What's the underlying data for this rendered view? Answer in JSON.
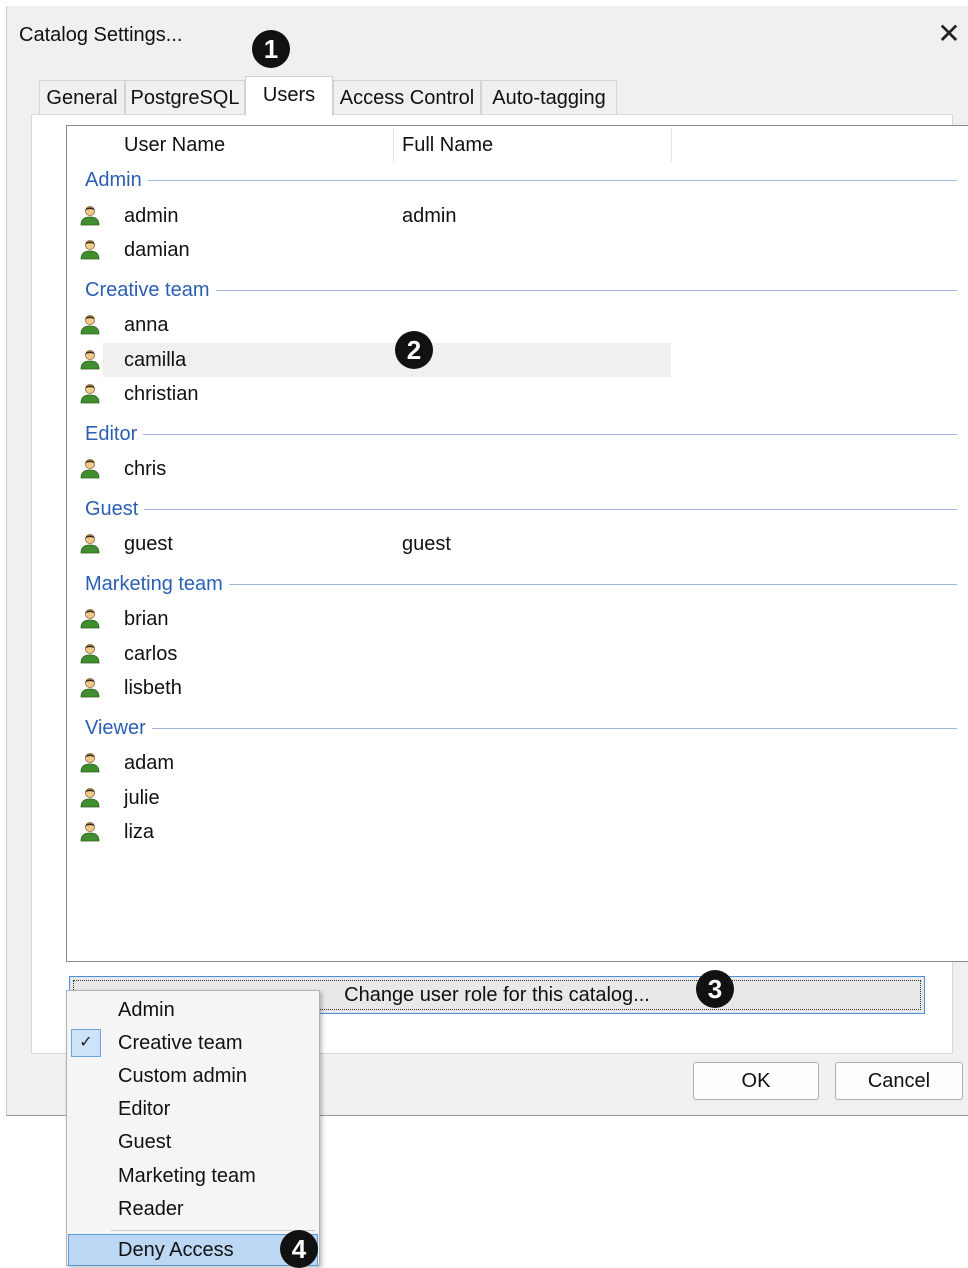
{
  "window": {
    "title": "Catalog Settings...",
    "close_glyph": "✕"
  },
  "tabs": [
    {
      "label": "General"
    },
    {
      "label": "PostgreSQL"
    },
    {
      "label": "Users",
      "active": true
    },
    {
      "label": "Access Control"
    },
    {
      "label": "Auto-tagging"
    }
  ],
  "columns": {
    "user_name": "User Name",
    "full_name": "Full Name"
  },
  "groups": [
    {
      "name": "Admin",
      "users": [
        {
          "name": "admin",
          "full_name": "admin"
        },
        {
          "name": "damian",
          "full_name": ""
        }
      ]
    },
    {
      "name": "Creative team",
      "users": [
        {
          "name": "anna",
          "full_name": ""
        },
        {
          "name": "camilla",
          "full_name": "",
          "selected": true
        },
        {
          "name": "christian",
          "full_name": ""
        }
      ]
    },
    {
      "name": "Editor",
      "users": [
        {
          "name": "chris",
          "full_name": ""
        }
      ]
    },
    {
      "name": "Guest",
      "users": [
        {
          "name": "guest",
          "full_name": "guest"
        }
      ]
    },
    {
      "name": "Marketing team",
      "users": [
        {
          "name": "brian",
          "full_name": ""
        },
        {
          "name": "carlos",
          "full_name": ""
        },
        {
          "name": "lisbeth",
          "full_name": ""
        }
      ]
    },
    {
      "name": "Viewer",
      "users": [
        {
          "name": "adam",
          "full_name": ""
        },
        {
          "name": "julie",
          "full_name": ""
        },
        {
          "name": "liza",
          "full_name": ""
        }
      ]
    }
  ],
  "role_button": {
    "label": "Change user role for this catalog..."
  },
  "buttons": {
    "ok": "OK",
    "cancel": "Cancel"
  },
  "role_menu": {
    "items": [
      {
        "label": "Admin"
      },
      {
        "label": "Creative team",
        "checked": true,
        "check_glyph": "✓"
      },
      {
        "label": "Custom admin"
      },
      {
        "label": "Editor"
      },
      {
        "label": "Guest"
      },
      {
        "label": "Marketing team"
      },
      {
        "label": "Reader"
      }
    ],
    "deny": {
      "label": "Deny Access",
      "highlighted": true
    }
  },
  "callouts": [
    "1",
    "2",
    "3",
    "4"
  ],
  "colors": {
    "group_label": "#2b5fb4",
    "group_line": "#9eb6da",
    "menu_highlight": "#bcd7f3",
    "user_icon_body": "#3f8f2e",
    "user_icon_head": "#f0c98e"
  }
}
